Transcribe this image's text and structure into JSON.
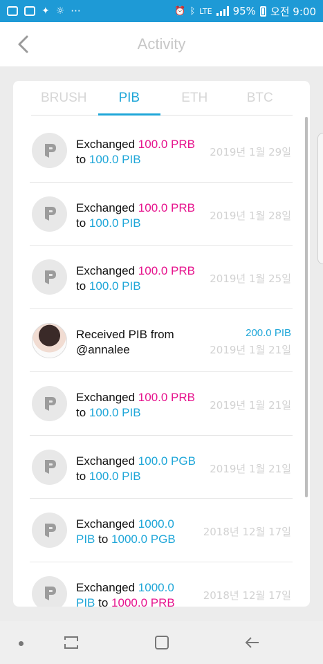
{
  "status_bar": {
    "network": "LTE",
    "battery": "95%",
    "time": "오전 9:00",
    "more": "···"
  },
  "header": {
    "title": "Activity"
  },
  "tabs": [
    {
      "label": "BRUSH",
      "active": false
    },
    {
      "label": "PIB",
      "active": true
    },
    {
      "label": "ETH",
      "active": false
    },
    {
      "label": "BTC",
      "active": false
    }
  ],
  "activities": [
    {
      "prefix": "Exchanged ",
      "from_amount": "100.0 PRB",
      "middle": " to ",
      "to_amount": "100.0 PIB",
      "date": "2019년 1월 29일"
    },
    {
      "prefix": "Exchanged ",
      "from_amount": "100.0 PRB",
      "middle": " to ",
      "to_amount": "100.0 PIB",
      "date": "2019년 1월 28일"
    },
    {
      "prefix": "Exchanged ",
      "from_amount": "100.0 PRB",
      "middle": " to ",
      "to_amount": "100.0 PIB",
      "date": "2019년 1월 25일"
    },
    {
      "line1": "Received PIB from",
      "line2": "@annalee",
      "amount": "200.0 PIB",
      "date": "2019년 1월 21일"
    },
    {
      "prefix": "Exchanged ",
      "from_amount": "100.0 PRB",
      "middle": " to ",
      "to_amount": "100.0 PIB",
      "date": "2019년 1월 21일"
    },
    {
      "prefix": "Exchanged ",
      "from_amount": "100.0 PGB",
      "middle": " to ",
      "to_amount": "100.0 PIB",
      "date": "2019년 1월 21일"
    },
    {
      "prefix": "Exchanged ",
      "from_amount_a": "1000.0",
      "from_amount_b": "PIB",
      "middle": " to ",
      "to_amount": "1000.0 PGB",
      "date": "2018년 12월 17일"
    },
    {
      "prefix": "Exchanged ",
      "from_amount_a": "1000.0",
      "from_amount_b": "PIB",
      "middle": " to ",
      "to_amount": "1000.0 PRB",
      "date": "2018년 12월 17일"
    }
  ],
  "colors": {
    "accent": "#1ea6d8",
    "pink": "#e6138d",
    "status_bar": "#1e9ad6"
  }
}
